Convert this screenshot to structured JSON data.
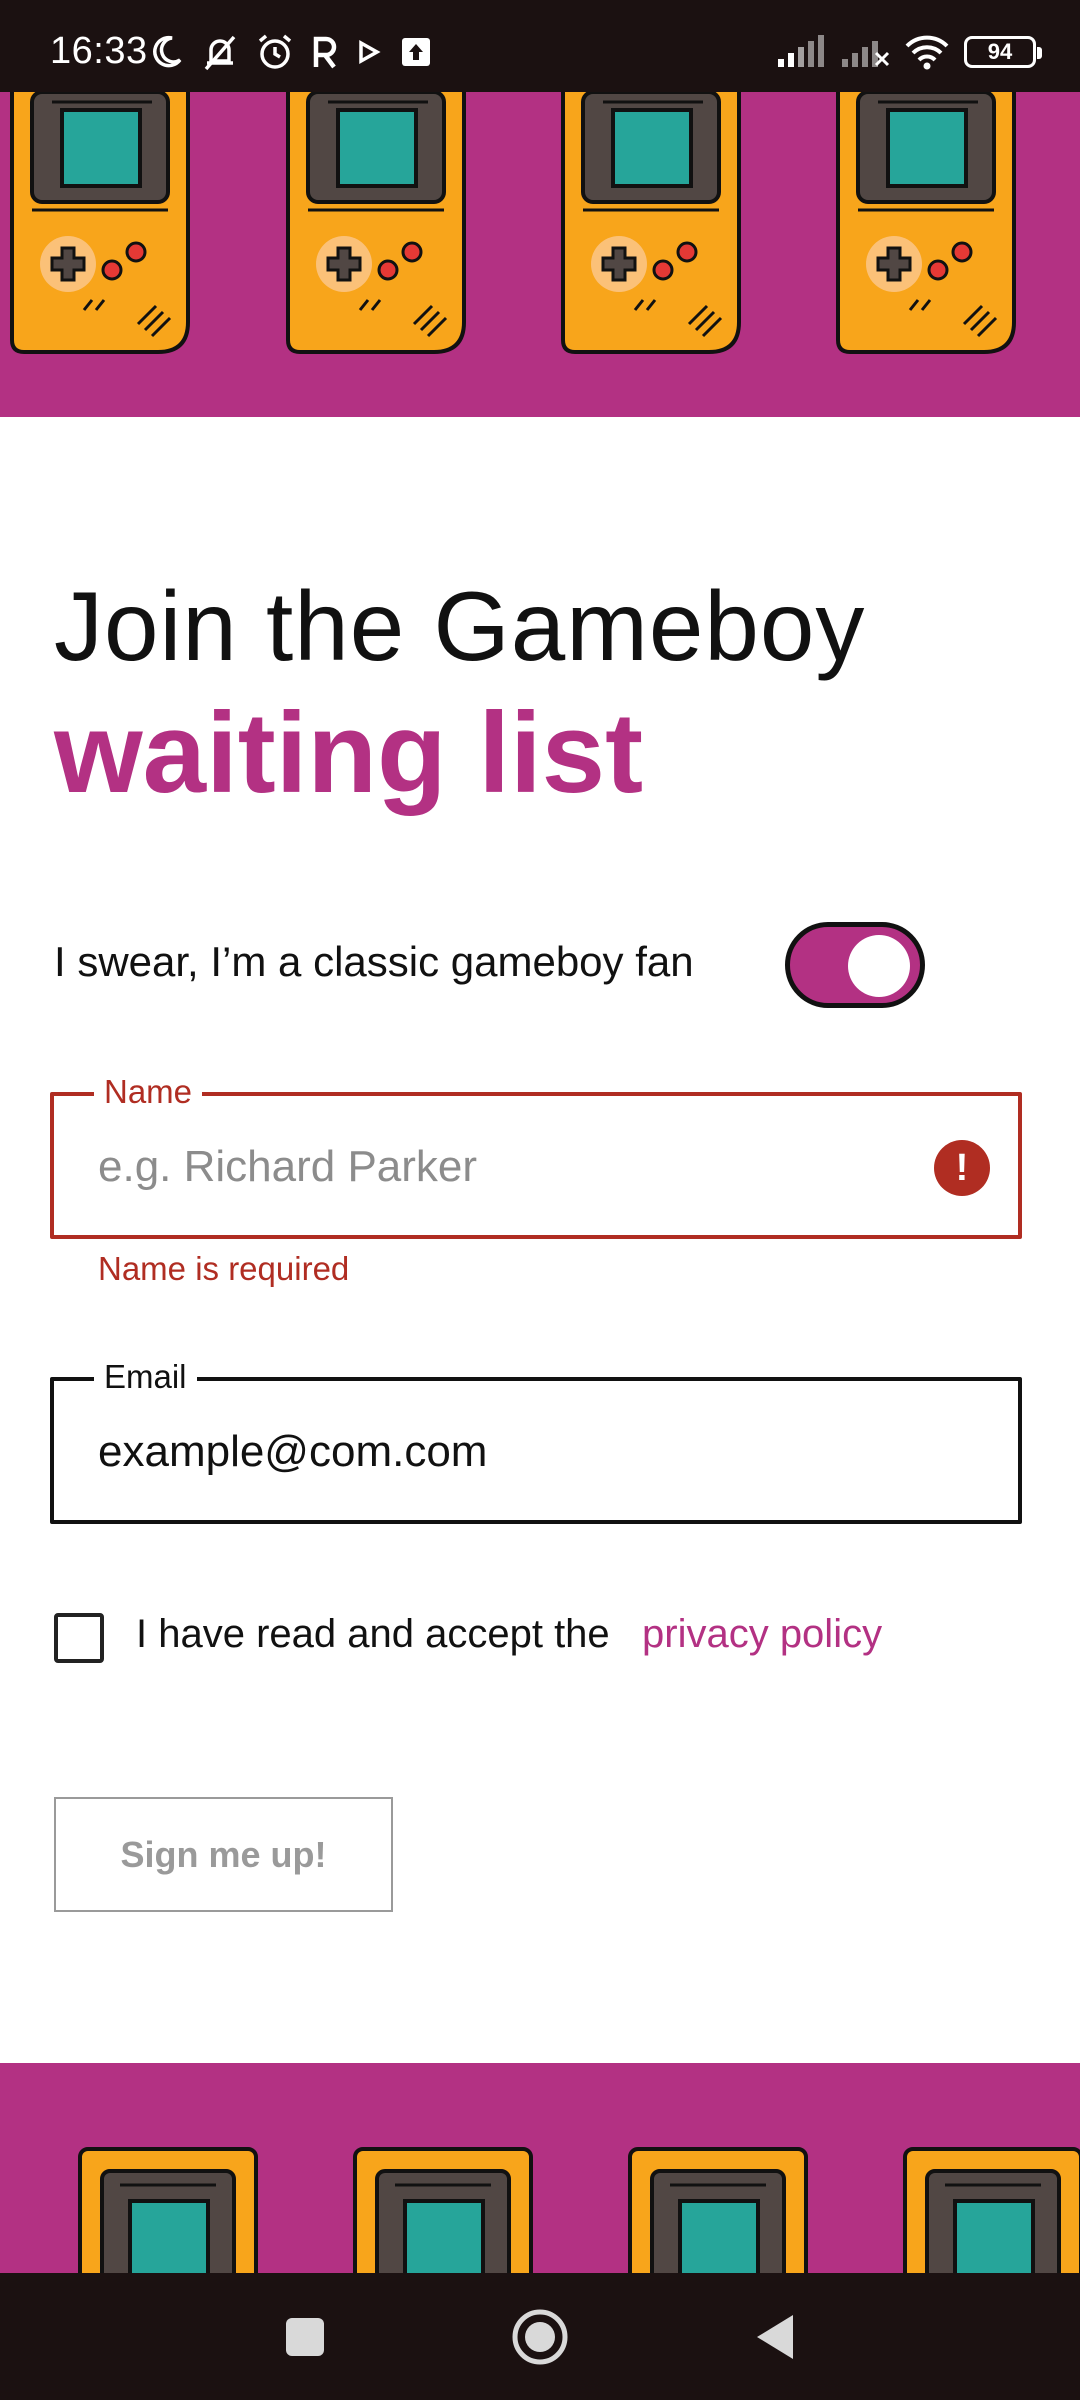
{
  "status_bar": {
    "time": "16:33",
    "battery_level": "94",
    "left_icons": [
      "moon-icon",
      "bell-off-icon",
      "alarm-icon",
      "r-app-icon",
      "play-icon",
      "upload-icon"
    ],
    "right_icons": [
      "signal-icon",
      "signal-no-service-icon",
      "wifi-icon",
      "battery-icon"
    ]
  },
  "heading": {
    "line1": "Join the Gameboy",
    "line2": "waiting list"
  },
  "toggle": {
    "label": "I swear, I’m a classic gameboy fan",
    "state": "on"
  },
  "form": {
    "name": {
      "label": "Name",
      "placeholder": "e.g. Richard Parker",
      "value": "",
      "error": "Name is required"
    },
    "email": {
      "label": "Email",
      "value": "example@com.com"
    },
    "privacy": {
      "label": "I have read and accept the",
      "link_text": "privacy policy",
      "checked": false
    },
    "submit_label": "Sign me up!"
  },
  "colors": {
    "accent": "#b33183",
    "error": "#b02d22",
    "gameboy_body": "#f8a51b",
    "gameboy_screen": "#26a59a",
    "system_bar": "#1b1111"
  },
  "nav_bar": {
    "icons": [
      "recents-square-icon",
      "home-circle-icon",
      "back-triangle-icon"
    ]
  }
}
